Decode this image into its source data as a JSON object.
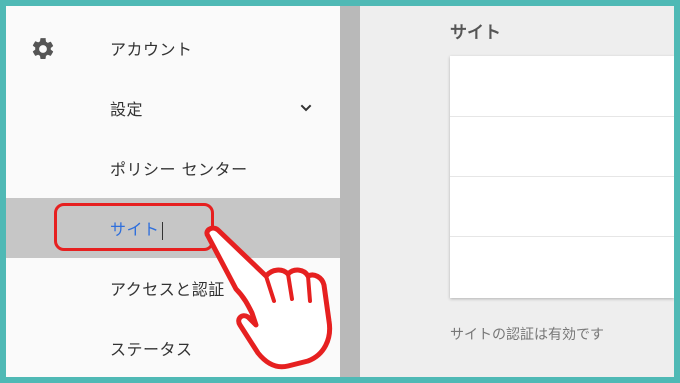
{
  "sidebar": {
    "items": [
      {
        "label": "アカウント",
        "has_chevron": false,
        "active": false
      },
      {
        "label": "設定",
        "has_chevron": true,
        "active": false
      },
      {
        "label": "ポリシー センター",
        "has_chevron": false,
        "active": false
      },
      {
        "label": "サイト",
        "has_chevron": false,
        "active": true
      },
      {
        "label": "アクセスと認証",
        "has_chevron": true,
        "active": false
      },
      {
        "label": "ステータス",
        "has_chevron": false,
        "active": false
      }
    ],
    "settings_icon": "gear-icon",
    "chevron_icon": "chevron-down-icon"
  },
  "main": {
    "title": "サイト",
    "status": "サイトの認証は有効です"
  },
  "annotation": {
    "pointer_icon": "pointing-hand-icon",
    "highlight_color": "#e62020"
  },
  "colors": {
    "frame": "#4fb9b5",
    "active_text": "#2f6fdc",
    "active_bg": "#c6c6c6"
  }
}
